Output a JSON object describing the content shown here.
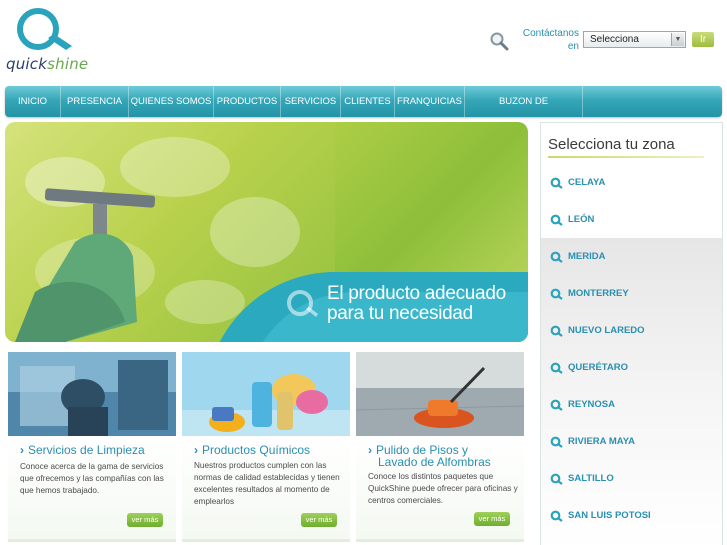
{
  "brand": {
    "logo_part1": "quick",
    "logo_part2": "shine"
  },
  "header": {
    "contact_label": "Contáctanos en",
    "select_value": "Selecciona",
    "go_label": "Ir"
  },
  "nav": {
    "items": [
      {
        "label": "INICIO"
      },
      {
        "label": "PRESENCIA EN"
      },
      {
        "label": "QUIENES SOMOS"
      },
      {
        "label": "PRODUCTOS"
      },
      {
        "label": "SERVICIOS"
      },
      {
        "label": "CLIENTES"
      },
      {
        "label": "FRANQUICIAS"
      },
      {
        "label": "BUZON DE SUGERENCIAS"
      }
    ]
  },
  "hero": {
    "caption_line1": "El producto adecuado",
    "caption_line2": "para tu necesidad"
  },
  "cards": [
    {
      "title": "Servicios de Limpieza",
      "text": "Conoce acerca de la gama de servicios que ofrecemos y las compañías con las que hemos trabajado.",
      "button": "ver más"
    },
    {
      "title": "Productos Químicos",
      "text": "Nuestros productos cumplen con las normas de calidad establecidas y tienen excelentes resultados al momento de emplearlos",
      "button": "ver más"
    },
    {
      "title_line1": "Pulido de Pisos y",
      "title_line2": "Lavado de Alfombras",
      "text": "Conoce los distintos paquetes que QuickShine puede ofrecer para oficinas y centros comerciales.",
      "button": "ver más"
    }
  ],
  "zone": {
    "title": "Selecciona tu zona",
    "items": [
      {
        "label": "CELAYA"
      },
      {
        "label": "LEÓN"
      },
      {
        "label": "MERIDA"
      },
      {
        "label": "MONTERREY"
      },
      {
        "label": "NUEVO LAREDO"
      },
      {
        "label": "QUERÉTARO"
      },
      {
        "label": "REYNOSA"
      },
      {
        "label": "RIVIERA MAYA"
      },
      {
        "label": "SALTILLO"
      },
      {
        "label": "SAN LUIS POTOSI"
      }
    ]
  },
  "colors": {
    "accent": "#2a8fb0",
    "nav": "#36a7b9",
    "green": "#8dbf3a"
  },
  "icons": {
    "search": "search-icon",
    "zone_bullet": "q-bullet-icon"
  }
}
